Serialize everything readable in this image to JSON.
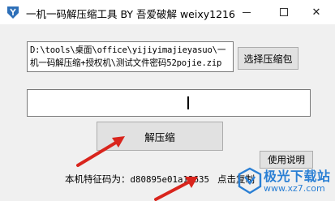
{
  "window": {
    "title": "一机一码解压缩工具 BY 吾爱破解 weixy1216"
  },
  "file": {
    "path": "D:\\tools\\桌面\\office\\yijiyimajieyasuo\\一机一码解压缩+授权机\\测试文件密码52pojie.zip"
  },
  "buttons": {
    "select_archive": "选择压缩包",
    "decompress": "解压缩",
    "help": "使用说明"
  },
  "password_input": {
    "value": ""
  },
  "machine": {
    "label": "本机特征码为：",
    "code": "d80895e01a13635",
    "copy_link": "点击复制"
  },
  "watermark": {
    "line1": "极光下载站",
    "line2": "www.xz7.com"
  },
  "colors": {
    "arrow": "#d9251d",
    "watermark": "#2a7fd4",
    "background": "#f0f0f0"
  }
}
